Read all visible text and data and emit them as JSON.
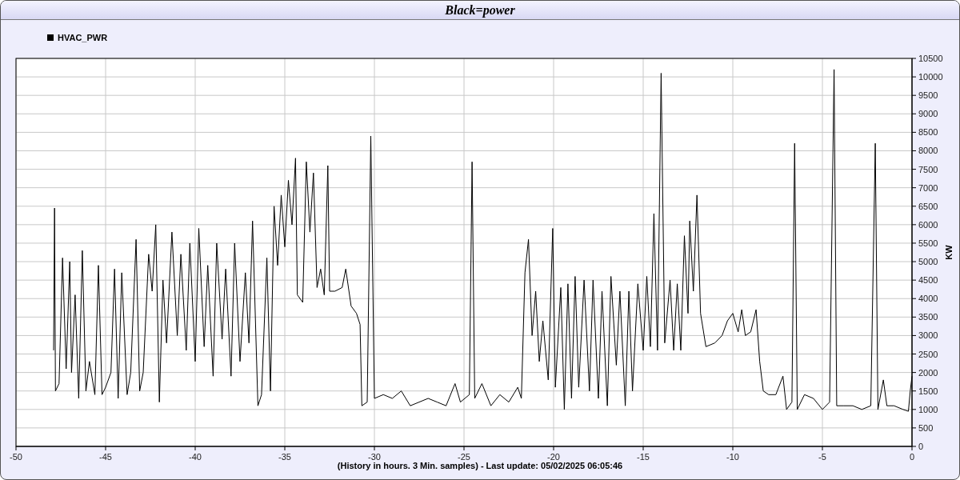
{
  "chart": {
    "chart_data": {
      "type": "line",
      "grid": true,
      "title": "Black=power",
      "xlabel": "(History in hours. 3 Min. samples) - Last update: 05/02/2025 06:05:46",
      "ylabel": "KW",
      "x": [
        -47.9,
        -47.85,
        -47.8,
        -47.6,
        -47.4,
        -47.2,
        -47.0,
        -46.9,
        -46.7,
        -46.5,
        -46.3,
        -46.1,
        -45.9,
        -45.6,
        -45.4,
        -45.2,
        -45.0,
        -44.7,
        -44.5,
        -44.3,
        -44.1,
        -43.8,
        -43.6,
        -43.3,
        -43.1,
        -42.9,
        -42.6,
        -42.4,
        -42.2,
        -42.0,
        -41.8,
        -41.6,
        -41.3,
        -41.0,
        -40.8,
        -40.5,
        -40.3,
        -40.0,
        -39.8,
        -39.5,
        -39.3,
        -39.0,
        -38.8,
        -38.5,
        -38.3,
        -38.0,
        -37.8,
        -37.5,
        -37.2,
        -37.0,
        -36.8,
        -36.5,
        -36.3,
        -36.0,
        -35.8,
        -35.6,
        -35.4,
        -35.2,
        -35.0,
        -34.8,
        -34.6,
        -34.4,
        -34.3,
        -34.0,
        -33.8,
        -33.6,
        -33.4,
        -33.2,
        -33.0,
        -32.8,
        -32.6,
        -32.5,
        -32.2,
        -31.8,
        -31.6,
        -31.3,
        -31.0,
        -30.8,
        -30.7,
        -30.4,
        -30.2,
        -30.0,
        -29.5,
        -29.0,
        -28.5,
        -28.0,
        -27.5,
        -27.0,
        -26.5,
        -26.0,
        -25.5,
        -25.2,
        -24.7,
        -24.55,
        -24.4,
        -24.0,
        -23.5,
        -23.0,
        -22.5,
        -22.0,
        -21.8,
        -21.6,
        -21.4,
        -21.2,
        -21.0,
        -20.8,
        -20.6,
        -20.3,
        -20.05,
        -19.9,
        -19.6,
        -19.4,
        -19.2,
        -19.0,
        -18.8,
        -18.6,
        -18.3,
        -18.0,
        -17.8,
        -17.5,
        -17.3,
        -17.0,
        -16.8,
        -16.5,
        -16.3,
        -16.0,
        -15.8,
        -15.6,
        -15.3,
        -15.0,
        -14.8,
        -14.6,
        -14.4,
        -14.2,
        -14.0,
        -13.8,
        -13.5,
        -13.3,
        -13.1,
        -12.9,
        -12.7,
        -12.5,
        -12.4,
        -12.2,
        -12.0,
        -11.8,
        -11.5,
        -11.0,
        -10.6,
        -10.3,
        -10.0,
        -9.7,
        -9.5,
        -9.3,
        -9.0,
        -8.7,
        -8.5,
        -8.3,
        -8.0,
        -7.6,
        -7.2,
        -7.0,
        -6.7,
        -6.55,
        -6.4,
        -6.0,
        -5.5,
        -5.0,
        -4.6,
        -4.35,
        -4.2,
        -3.8,
        -3.3,
        -2.8,
        -2.3,
        -2.05,
        -1.9,
        -1.6,
        -1.4,
        -1.0,
        -0.5,
        -0.2,
        -0.1,
        0
      ],
      "series": [
        {
          "name": "HVAC_PWR",
          "color": "#000000",
          "values": [
            2600,
            6450,
            1500,
            1700,
            5100,
            2100,
            5000,
            2000,
            4100,
            1300,
            5300,
            1500,
            2300,
            1400,
            4900,
            1400,
            1600,
            2000,
            4800,
            1300,
            4700,
            1400,
            2000,
            5600,
            1500,
            2000,
            5200,
            4200,
            6000,
            1200,
            4500,
            2800,
            5800,
            3000,
            5200,
            2600,
            5500,
            2300,
            5900,
            2700,
            4900,
            1900,
            5500,
            2900,
            4800,
            1900,
            5500,
            2300,
            4700,
            2800,
            6100,
            1100,
            1400,
            5100,
            1500,
            6500,
            4900,
            6800,
            5400,
            7200,
            6000,
            7800,
            4100,
            3900,
            7700,
            5800,
            7400,
            4300,
            4800,
            4100,
            7600,
            4200,
            4200,
            4300,
            4800,
            3800,
            3600,
            3300,
            1100,
            1200,
            8400,
            1300,
            1400,
            1300,
            1500,
            1100,
            1200,
            1300,
            1200,
            1100,
            1700,
            1200,
            1400,
            7700,
            1300,
            1700,
            1100,
            1400,
            1200,
            1600,
            1300,
            4700,
            5600,
            3000,
            4200,
            2300,
            3400,
            1800,
            5900,
            1600,
            4300,
            1000,
            4400,
            1300,
            4600,
            1600,
            4500,
            1500,
            4500,
            1300,
            4200,
            1100,
            4600,
            2200,
            4200,
            1100,
            4200,
            1500,
            4400,
            2600,
            4600,
            2700,
            6300,
            2600,
            10100,
            2800,
            4500,
            2600,
            4400,
            2600,
            5700,
            3600,
            6100,
            4200,
            6800,
            3600,
            2700,
            2800,
            3000,
            3400,
            3600,
            3100,
            3700,
            3000,
            3100,
            3700,
            2300,
            1500,
            1400,
            1400,
            1900,
            1000,
            1200,
            8200,
            1000,
            1400,
            1300,
            1000,
            1200,
            10200,
            1100,
            1100,
            1100,
            1000,
            1100,
            8200,
            1000,
            1800,
            1100,
            1100,
            1000,
            950,
            1500,
            1900
          ]
        }
      ],
      "xlim": [
        -50,
        0
      ],
      "ylim": [
        0,
        10500
      ],
      "xticks": [
        -50,
        -45,
        -40,
        -35,
        -30,
        -25,
        -20,
        -15,
        -10,
        -5,
        0
      ],
      "yticks": [
        0,
        500,
        1000,
        1500,
        2000,
        2500,
        3000,
        3500,
        4000,
        4500,
        5000,
        5500,
        6000,
        6500,
        7000,
        7500,
        8000,
        8500,
        9000,
        9500,
        10000,
        10500
      ]
    }
  }
}
